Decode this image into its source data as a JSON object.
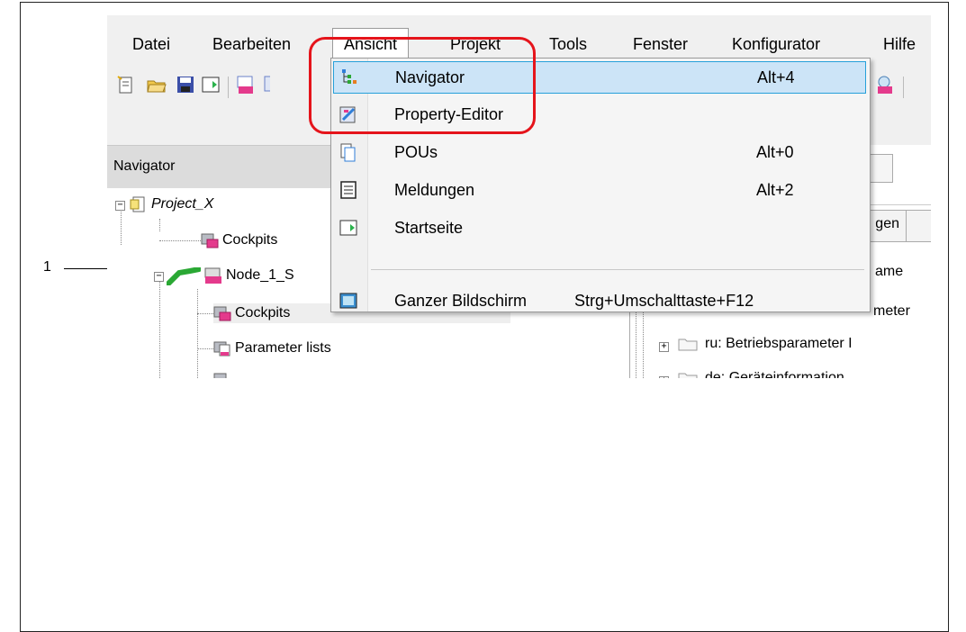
{
  "menubar": {
    "items": [
      "Datei",
      "Bearbeiten",
      "Ansicht",
      "Projekt",
      "Tools",
      "Fenster",
      "Konfigurator",
      "Hilfe"
    ]
  },
  "navigator": {
    "title": "Navigator",
    "tree": [
      {
        "label": "Project_X"
      },
      {
        "label": "Cockpits"
      },
      {
        "label": "Node_1_S"
      },
      {
        "label": "Cockpits"
      },
      {
        "label": "Parameter lists"
      }
    ]
  },
  "right_pane": {
    "tab_fragment": "gen",
    "rows": [
      "ame",
      "meter",
      "ru: Betriebsparameter I",
      "de: Geräteinformation"
    ]
  },
  "dropdown": {
    "items": [
      {
        "label": "Navigator",
        "shortcut": "Alt+4",
        "icon": "navigator-icon"
      },
      {
        "label": "Property-Editor",
        "shortcut": "",
        "icon": "property-editor-icon"
      },
      {
        "label": "POUs",
        "shortcut": "Alt+0",
        "icon": "pous-icon"
      },
      {
        "label": "Meldungen",
        "shortcut": "Alt+2",
        "icon": "messages-icon"
      },
      {
        "label": "Startseite",
        "shortcut": "",
        "icon": "start-page-icon"
      },
      {
        "label": "Ganzer Bildschirm",
        "shortcut": "Strg+Umschalttaste+F12",
        "icon": "fullscreen-icon"
      }
    ]
  },
  "annotation": {
    "label": "1"
  },
  "colors": {
    "highlight_bg": "#cce4f7",
    "highlight_border": "#26a0da",
    "callout": "#e5141b"
  }
}
